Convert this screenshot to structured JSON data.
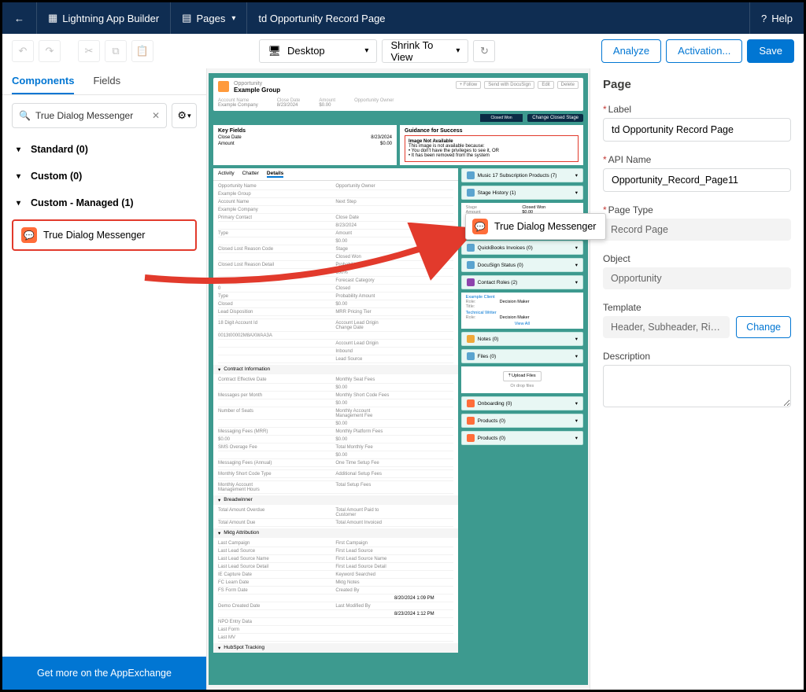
{
  "nav": {
    "builder": "Lightning App Builder",
    "pages": "Pages",
    "tabName": "td Opportunity Record Page",
    "help": "Help"
  },
  "toolbar": {
    "viewport": "Desktop",
    "zoom": "Shrink To View",
    "analyze": "Analyze",
    "activation": "Activation...",
    "save": "Save"
  },
  "left": {
    "tabComponents": "Components",
    "tabFields": "Fields",
    "searchValue": "True Dialog Messenger",
    "catStandard": "Standard (0)",
    "catCustom": "Custom (0)",
    "catManaged": "Custom - Managed (1)",
    "componentItem": "True Dialog Messenger",
    "footer": "Get more on the AppExchange"
  },
  "drag": {
    "label": "True Dialog Messenger"
  },
  "canvas": {
    "recordType": "Opportunity",
    "recordName": "Example Group",
    "hdrButtons": [
      "+ Follow",
      "Send with DocuSign",
      "Edit",
      "Delete"
    ],
    "hdrFields": [
      {
        "l": "Account Name",
        "v": "Example Company"
      },
      {
        "l": "Close Date",
        "v": "8/23/2024"
      },
      {
        "l": "Amount",
        "v": "$0.00"
      },
      {
        "l": "Opportunity Owner",
        "v": ""
      }
    ],
    "keyFieldsTitle": "Key Fields",
    "keyFields": [
      {
        "l": "Close Date",
        "v": "8/23/2024"
      },
      {
        "l": "Amount",
        "v": "$0.00"
      }
    ],
    "guidanceTitle": "Guidance for Success",
    "guidanceMsg1": "Image Not Available",
    "guidanceMsg2": "This image is not available because:",
    "guidanceMsg3": "• You don't have the privileges to see it, OR",
    "guidanceMsg4": "• It has been removed from the system",
    "pathCurrent": "Closed Won",
    "pathBtn": "Change Closed Stage",
    "tabs": [
      "Activity",
      "Chatter",
      "Details"
    ],
    "fieldRows": [
      [
        "Opportunity Name",
        "",
        "Opportunity Owner",
        ""
      ],
      [
        "Example Group",
        "",
        "",
        ""
      ],
      [
        "Account Name",
        "",
        "Next Step",
        ""
      ],
      [
        "Example Company",
        "",
        "",
        ""
      ],
      [
        "Primary Contact",
        "",
        "Close Date",
        ""
      ],
      [
        "",
        "",
        "8/23/2024",
        ""
      ],
      [
        "Type",
        "",
        "Amount",
        ""
      ],
      [
        "",
        "",
        "$0.00",
        ""
      ],
      [
        "Closed Lost Reason Code",
        "",
        "Stage",
        ""
      ],
      [
        "",
        "",
        "Closed Won",
        ""
      ],
      [
        "Closed Lost Reason Detail",
        "",
        "Probability (%)",
        ""
      ],
      [
        "",
        "",
        "100%",
        ""
      ],
      [
        "Open Opps",
        "",
        "Forecast Category",
        ""
      ],
      [
        "0",
        "",
        "Closed",
        ""
      ],
      [
        "Type",
        "",
        "Probability Amount",
        ""
      ],
      [
        "Closed",
        "",
        "$0.00",
        ""
      ],
      [
        "Lead Disposition",
        "",
        "MRR Pricing Tier",
        ""
      ],
      [
        "",
        "",
        "",
        ""
      ],
      [
        "18 Digit Account Id",
        "",
        "Account Lead Origin Change Date",
        ""
      ],
      [
        "0013t00002M8AXWAA3A",
        "",
        "",
        ""
      ],
      [
        "",
        "",
        "Account Lead Origin",
        ""
      ],
      [
        "",
        "",
        "Inbound",
        ""
      ],
      [
        "",
        "",
        "Lead Source",
        ""
      ]
    ],
    "section1": "Contract Information",
    "section1Rows": [
      [
        "Contract Effective Date",
        "",
        "Monthly Seat Fees",
        ""
      ],
      [
        "",
        "",
        "$0.00",
        ""
      ],
      [
        "Messages per Month",
        "",
        "Monthly Short Code Fees",
        ""
      ],
      [
        "",
        "",
        "$0.00",
        ""
      ],
      [
        "Number of Seats",
        "",
        "Monthly Account Management Fee",
        ""
      ],
      [
        "",
        "",
        "$0.00",
        ""
      ],
      [
        "Messaging Fees (MRR)",
        "",
        "Monthly Platform Fees",
        ""
      ],
      [
        "$0.00",
        "",
        "$0.00",
        ""
      ],
      [
        "SMS Overage Fee",
        "",
        "Total Monthly Fee",
        ""
      ],
      [
        "",
        "",
        "$0.00",
        ""
      ],
      [
        "Messaging Fees (Annual)",
        "",
        "One Time Setup Fee",
        ""
      ],
      [
        "",
        "",
        "",
        ""
      ],
      [
        "Monthly Short Code Type",
        "",
        "Additional Setup Fees",
        ""
      ],
      [
        "",
        "",
        "",
        ""
      ],
      [
        "Monthly Account Management Hours",
        "",
        "Total Setup Fees",
        ""
      ]
    ],
    "section2": "Breadwinner",
    "section2Rows": [
      [
        "Total Amount Overdue",
        "",
        "Total Amount Paid to Customer",
        ""
      ],
      [
        "Total Amount Due",
        "",
        "Total Amount Invoiced",
        ""
      ]
    ],
    "section3": "Mktg Attribution",
    "section3Rows": [
      [
        "Last Campaign",
        "",
        "First Campaign",
        ""
      ],
      [
        "Last Lead Source",
        "",
        "First Lead Source",
        ""
      ],
      [
        "Last Lead Source Name",
        "",
        "First Lead Source Name",
        ""
      ],
      [
        "Last Lead Source Detail",
        "",
        "First Lead Source Detail",
        ""
      ],
      [
        "IE Capture Date",
        "",
        "Keyword Searched",
        ""
      ],
      [
        "FC Learn Date",
        "",
        "Mktg Notes",
        ""
      ],
      [
        "FS Form Date",
        "",
        "Created By",
        ""
      ],
      [
        "",
        "",
        "",
        "8/20/2024  1:09 PM"
      ],
      [
        "Demo Created Date",
        "",
        "Last Modified By",
        ""
      ],
      [
        "",
        "",
        "",
        "8/23/2024  1:12 PM"
      ],
      [
        "NPO Entry Data",
        "",
        "",
        ""
      ],
      [
        "Last Form",
        "",
        "",
        ""
      ],
      [
        "Last MV",
        "",
        "",
        ""
      ]
    ],
    "section4": "HubSpot Tracking",
    "rightCards": [
      {
        "t": "Music 17 Subscription Products (7)",
        "c": "#5ba4cf"
      },
      {
        "t": "Stage History (1)",
        "c": "#5ba4cf"
      },
      {
        "t": "QuickBooks Invoices (0)",
        "c": "#5ba4cf"
      },
      {
        "t": "DocuSign Status (0)",
        "c": "#5ba4cf"
      },
      {
        "t": "Contact Roles (2)",
        "c": "#8e44ad"
      },
      {
        "t": "Notes (0)",
        "c": "#f0a839"
      },
      {
        "t": "Files (0)",
        "c": "#5ba4cf"
      },
      {
        "t": "Onboarding (0)",
        "c": "#ff6d3a"
      },
      {
        "t": "Products (0)",
        "c": "#ff6d3a"
      },
      {
        "t": "Products (0)",
        "c": "#ff6d3a"
      }
    ],
    "stageDetails": [
      [
        "Stage",
        "Closed Won"
      ],
      [
        "Amount",
        "$0.00"
      ],
      [
        "Probability (%)",
        "100%"
      ],
      [
        "Close Date",
        "8/23/2024"
      ],
      [
        "Last Modified",
        "8/23/2024 1:08 PM"
      ]
    ],
    "viewAll": "View All",
    "contactRole1": "Example Client",
    "contactRole1Role": "Decision Maker",
    "contactRole2": "Technical Writer",
    "contactRole2Role": "Decision Maker",
    "upload": "Upload Files",
    "dropFiles": "Or drop files"
  },
  "right": {
    "title": "Page",
    "label_lbl": "Label",
    "label_val": "td Opportunity Record Page",
    "api_lbl": "API Name",
    "api_val": "Opportunity_Record_Page11",
    "pagetype_lbl": "Page Type",
    "pagetype_val": "Record Page",
    "object_lbl": "Object",
    "object_val": "Opportunity",
    "template_lbl": "Template",
    "template_val": "Header, Subheader, Right Sid...",
    "change": "Change",
    "desc_lbl": "Description"
  }
}
